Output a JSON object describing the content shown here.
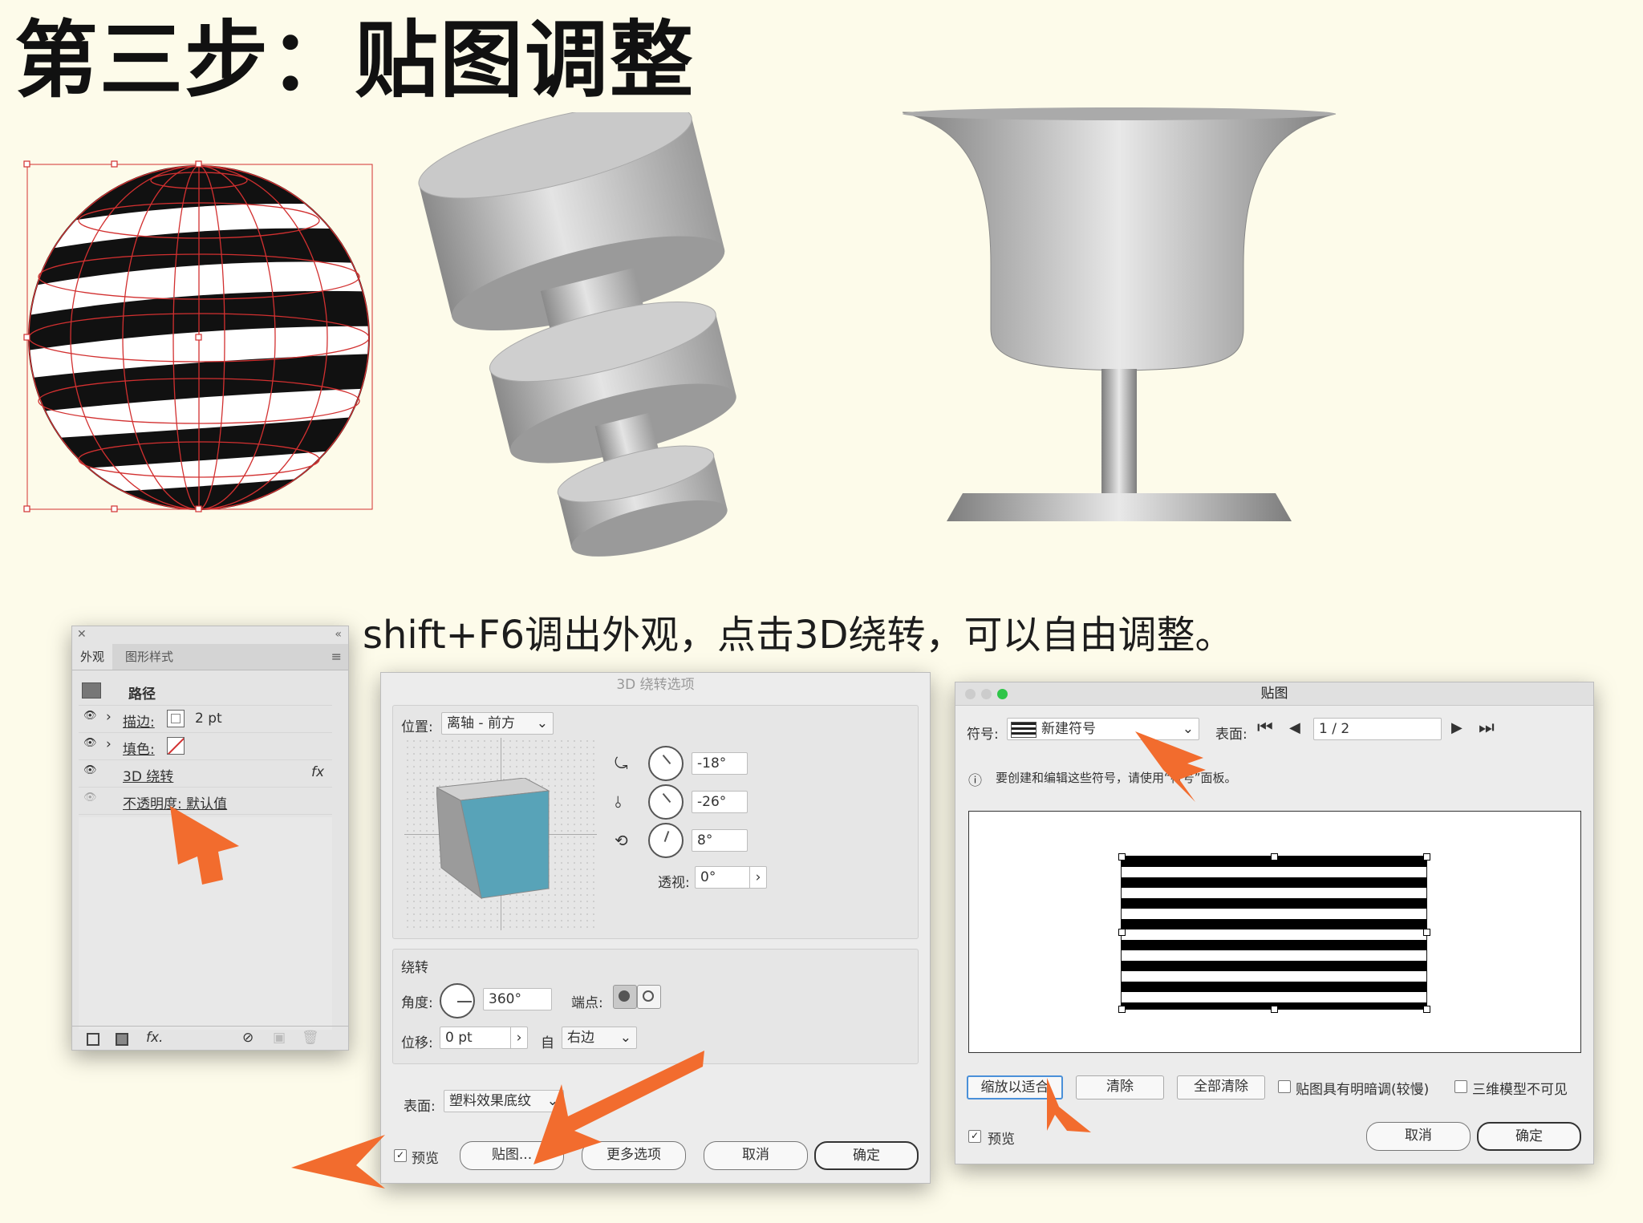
{
  "title": "第三步：贴图调整",
  "caption": "shift+F6调出外观，点击3D绕转，可以自由调整。",
  "appearance_panel": {
    "tabs": [
      "外观",
      "图形样式"
    ],
    "object_label": "路径",
    "rows": [
      {
        "label": "描边:",
        "value": "2 pt"
      },
      {
        "label": "填色:",
        "value": ""
      },
      {
        "label": "3D 绕转",
        "value": "fx"
      },
      {
        "label": "不透明度: 默认值",
        "value": ""
      }
    ],
    "footer_fx": "fx."
  },
  "revolve_dialog": {
    "title": "3D 绕转选项",
    "position_label": "位置:",
    "position_value": "离轴 - 前方",
    "rot_x": "-18°",
    "rot_y": "-26°",
    "rot_z": "8°",
    "perspective_label": "透视:",
    "perspective_value": "0°",
    "revolve_header": "绕转",
    "angle_label": "角度:",
    "angle_value": "360°",
    "cap_label": "端点:",
    "offset_label": "位移:",
    "offset_value": "0 pt",
    "from_label": "自",
    "from_value": "右边",
    "surface_label": "表面:",
    "surface_value": "塑料效果底纹",
    "preview_label": "预览",
    "buttons": [
      "贴图...",
      "更多选项",
      "取消",
      "确定"
    ],
    "cube_face_color": "#58a3b8"
  },
  "map_dialog": {
    "title": "贴图",
    "symbol_label": "符号:",
    "symbol_value": "新建符号",
    "surface_label": "表面:",
    "surface_value": "1 / 2",
    "info_text": "要创建和编辑这些符号，请使用“符号”面板。",
    "buttons": [
      "缩放以适合",
      "清除",
      "全部清除"
    ],
    "checkbox_shade": "贴图具有明暗调(较慢)",
    "checkbox_invisible": "三维模型不可见",
    "preview_label": "预览",
    "cancel": "取消",
    "ok": "确定"
  },
  "colors": {
    "accent_arrow": "#f26c2e",
    "wire": "#d23030",
    "background": "#fdfbea"
  }
}
